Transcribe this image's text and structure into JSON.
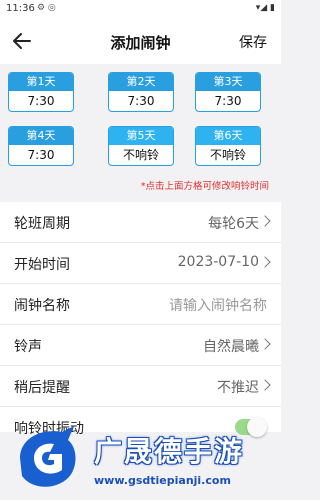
{
  "status": {
    "time": "11:36",
    "icons_left": "⚙ ◎",
    "icons_right": "▾◢ ▮"
  },
  "appbar": {
    "title": "添加闹钟",
    "save_label": "保存"
  },
  "days": [
    {
      "label": "第1天",
      "value": "7:30"
    },
    {
      "label": "第2天",
      "value": "7:30"
    },
    {
      "label": "第3天",
      "value": "7:30"
    },
    {
      "label": "第4天",
      "value": "7:30"
    },
    {
      "label": "第5天",
      "value": "不响铃"
    },
    {
      "label": "第6天",
      "value": "不响铃"
    }
  ],
  "hint": "*点击上面方格可修改响铃时间",
  "settings": {
    "cycle": {
      "label": "轮班周期",
      "value": "每轮6天"
    },
    "start": {
      "label": "开始时间",
      "value": "2023-07-10"
    },
    "name": {
      "label": "闹钟名称",
      "placeholder": "请输入闹钟名称"
    },
    "ringtone": {
      "label": "铃声",
      "value": "自然晨曦"
    },
    "snooze": {
      "label": "稍后提醒",
      "value": "不推迟"
    },
    "vibrate": {
      "label": "响铃时振动",
      "on": true
    }
  },
  "watermark": {
    "text": "广晟德手游",
    "url": "www.gsdtiepianji.com"
  },
  "colors": {
    "accent": "#2a9fe0",
    "hint": "#e03030",
    "toggle": "#9bd98a"
  }
}
